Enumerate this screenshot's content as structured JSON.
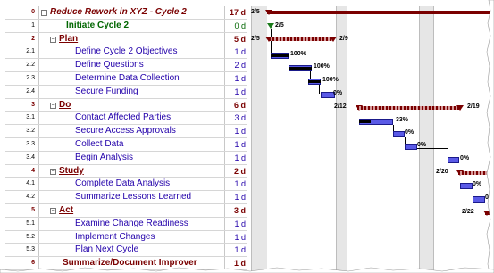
{
  "tasks": [
    {
      "id": "0",
      "name": "Reduce Rework in XYZ - Cycle 2",
      "dur": "17 d",
      "level": "lv0",
      "toggle": "−"
    },
    {
      "id": "1",
      "name": "Initiate Cycle 2",
      "dur": "0 d",
      "level": "lvm",
      "toggle": ""
    },
    {
      "id": "2",
      "name": "Plan",
      "dur": "5 d",
      "level": "lv1",
      "toggle": "−"
    },
    {
      "id": "2.1",
      "name": "Define Cycle 2 Objectives",
      "dur": "1 d",
      "level": "lv2",
      "toggle": ""
    },
    {
      "id": "2.2",
      "name": "Define Questions",
      "dur": "2 d",
      "level": "lv2",
      "toggle": ""
    },
    {
      "id": "2.3",
      "name": "Determine Data Collection",
      "dur": "1 d",
      "level": "lv2",
      "toggle": ""
    },
    {
      "id": "2.4",
      "name": "Secure Funding",
      "dur": "1 d",
      "level": "lv2",
      "toggle": ""
    },
    {
      "id": "3",
      "name": "Do",
      "dur": "6 d",
      "level": "lv1",
      "toggle": "−"
    },
    {
      "id": "3.1",
      "name": "Contact Affected Parties",
      "dur": "3 d",
      "level": "lv2",
      "toggle": ""
    },
    {
      "id": "3.2",
      "name": "Secure Access Approvals",
      "dur": "1 d",
      "level": "lv2",
      "toggle": ""
    },
    {
      "id": "3.3",
      "name": "Collect Data",
      "dur": "1 d",
      "level": "lv2",
      "toggle": ""
    },
    {
      "id": "3.4",
      "name": "Begin Analysis",
      "dur": "1 d",
      "level": "lv2",
      "toggle": ""
    },
    {
      "id": "4",
      "name": "Study",
      "dur": "2 d",
      "level": "lv1",
      "toggle": "−"
    },
    {
      "id": "4.1",
      "name": "Complete Data Analysis",
      "dur": "1 d",
      "level": "lv2",
      "toggle": ""
    },
    {
      "id": "4.2",
      "name": "Summarize Lessons Learned",
      "dur": "1 d",
      "level": "lv2",
      "toggle": ""
    },
    {
      "id": "5",
      "name": "Act",
      "dur": "3 d",
      "level": "lv1",
      "toggle": "−"
    },
    {
      "id": "5.1",
      "name": "Examine Change Readiness",
      "dur": "1 d",
      "level": "lv2",
      "toggle": ""
    },
    {
      "id": "5.2",
      "name": "Implement Changes",
      "dur": "1 d",
      "level": "lv2",
      "toggle": ""
    },
    {
      "id": "5.3",
      "name": "Plan Next Cycle",
      "dur": "1 d",
      "level": "lv2",
      "toggle": ""
    },
    {
      "id": "6",
      "name": "Summarize/Document Improver",
      "dur": "1 d",
      "level": "lvs",
      "toggle": ""
    }
  ],
  "gantt": {
    "summary_labels": {
      "cycle_start": "2/5",
      "plan_start": "2/5",
      "plan_end": "2/9",
      "do_start": "2/12",
      "do_end": "2/19",
      "study_start": "2/20",
      "act_start": "2/22"
    },
    "milestone_label": "2/5",
    "progress_labels": [
      "100%",
      "100%",
      "100%",
      "0%",
      "33%",
      "0%",
      "0%",
      "0%",
      "0%",
      "0%"
    ],
    "colors": {
      "summary": "#7a0000",
      "task": "#5a5ae6",
      "milestone": "#1a7a1a",
      "weekend": "#e6e6e6"
    }
  }
}
